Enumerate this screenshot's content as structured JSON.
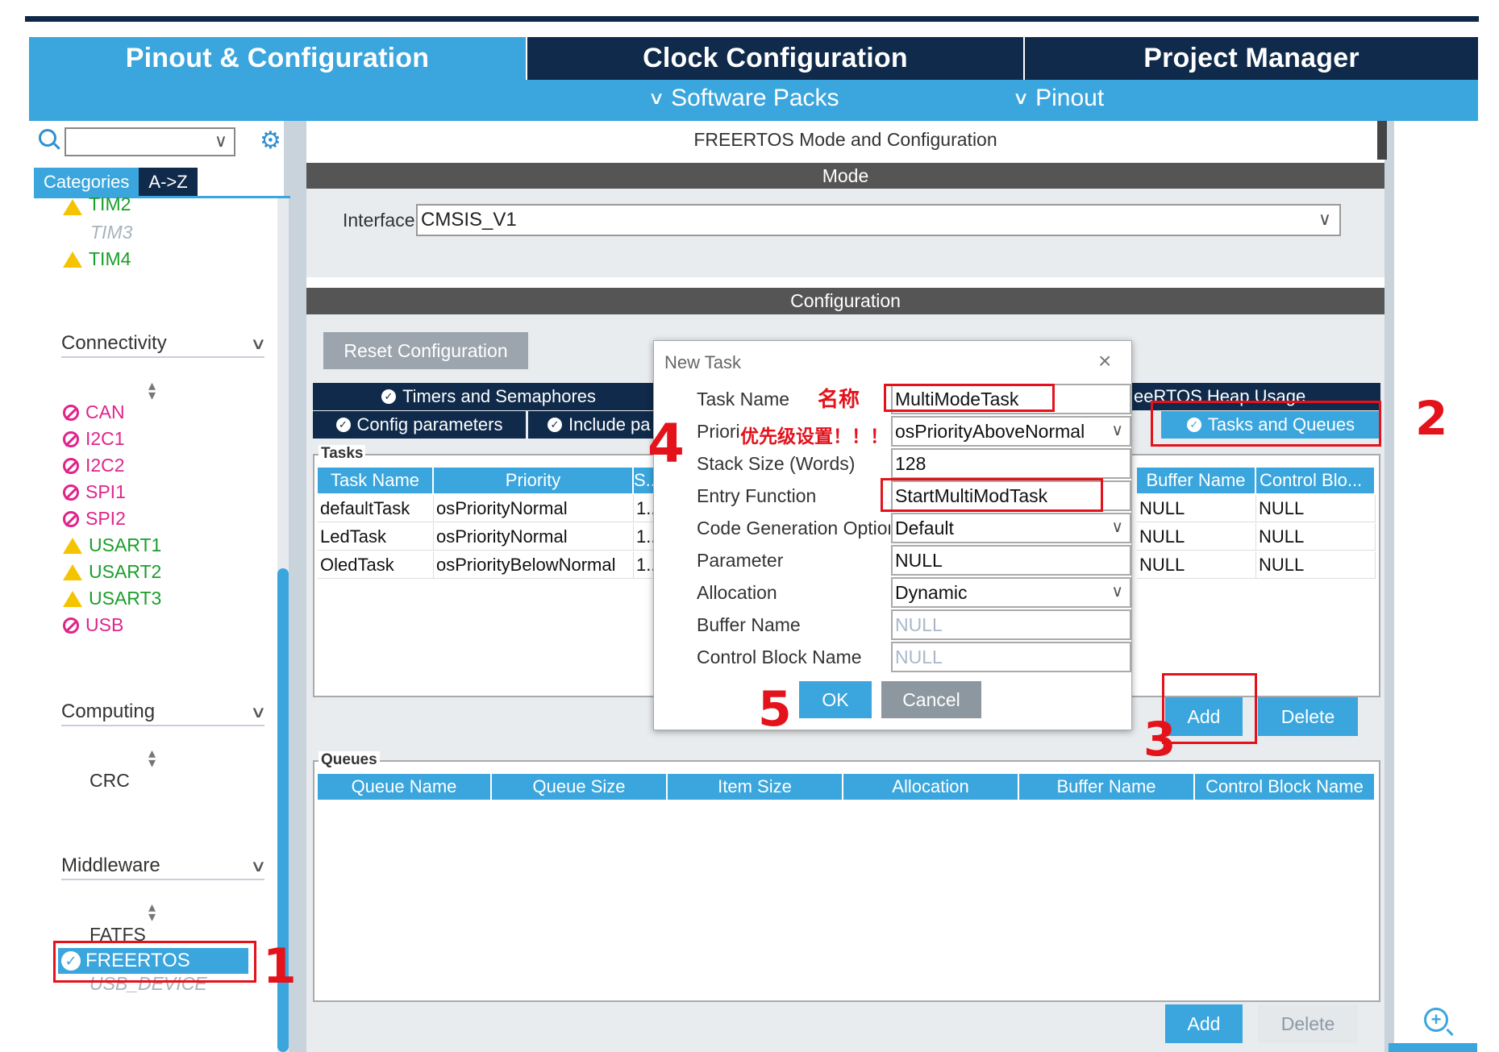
{
  "tabs": {
    "pinout": "Pinout & Configuration",
    "clock": "Clock Configuration",
    "project": "Project Manager"
  },
  "subbar": {
    "software_packs": "Software Packs",
    "pinout": "Pinout"
  },
  "sidebar": {
    "categories_tab": "Categories",
    "az_tab": "A->Z",
    "timers": [
      "TIM2",
      "TIM3",
      "TIM4"
    ],
    "connectivity": {
      "title": "Connectivity",
      "items": [
        "CAN",
        "I2C1",
        "I2C2",
        "SPI1",
        "SPI2",
        "USART1",
        "USART2",
        "USART3",
        "USB"
      ]
    },
    "computing": {
      "title": "Computing",
      "items": [
        "CRC"
      ]
    },
    "middleware": {
      "title": "Middleware",
      "items": [
        "FATFS",
        "FREERTOS",
        "USB_DEVICE"
      ]
    }
  },
  "main": {
    "mode_title": "FREERTOS Mode and Configuration",
    "mode_header": "Mode",
    "interface_label": "Interface",
    "interface_value": "CMSIS_V1",
    "config_header": "Configuration",
    "reset_button": "Reset Configuration",
    "config_tabs": [
      "Timers and Semaphores",
      "Config parameters",
      "Include pa",
      "eeRTOS Heap Usage",
      "Tasks and Queues"
    ],
    "tasks_legend": "Tasks",
    "task_columns": [
      "Task Name",
      "Priority",
      "S..",
      "Buffer Name",
      "Control Blo..."
    ],
    "task_rows": [
      {
        "name": "defaultTask",
        "priority": "osPriorityNormal",
        "stack": "1..",
        "buffer": "NULL",
        "cb": "NULL"
      },
      {
        "name": "LedTask",
        "priority": "osPriorityNormal",
        "stack": "1..",
        "buffer": "NULL",
        "cb": "NULL"
      },
      {
        "name": "OledTask",
        "priority": "osPriorityBelowNormal",
        "stack": "1..",
        "buffer": "NULL",
        "cb": "NULL"
      }
    ],
    "tasks_add": "Add",
    "tasks_delete": "Delete",
    "queues_legend": "Queues",
    "queue_columns": [
      "Queue Name",
      "Queue Size",
      "Item Size",
      "Allocation",
      "Buffer Name",
      "Control Block Name"
    ],
    "queues_add": "Add",
    "queues_delete": "Delete"
  },
  "dialog": {
    "title": "New Task",
    "close": "×",
    "labels": {
      "task_name": "Task Name",
      "priority": "Priori",
      "stack_size": "Stack Size (Words)",
      "entry_function": "Entry Function",
      "code_gen": "Code Generation Option",
      "parameter": "Parameter",
      "allocation": "Allocation",
      "buffer_name": "Buffer Name",
      "control_block": "Control Block Name"
    },
    "values": {
      "task_name": "MultiModeTask",
      "priority": "osPriorityAboveNormal",
      "stack_size": "128",
      "entry_function": "StartMultiModTask",
      "code_gen": "Default",
      "parameter": "NULL",
      "allocation": "Dynamic",
      "buffer_name": "NULL",
      "control_block": "NULL"
    },
    "ok": "OK",
    "cancel": "Cancel"
  },
  "annotations": {
    "name_note": "名称",
    "priority_note": "优先级设置！！！",
    "n1": "1",
    "n2": "2",
    "n3": "3",
    "n4": "4",
    "n5": "5"
  },
  "colors": {
    "accent": "#3aa6dd",
    "dark": "#0f2a4a",
    "annotation": "#e3121b",
    "warning": "#1a9e2a",
    "error": "#e0248c"
  }
}
